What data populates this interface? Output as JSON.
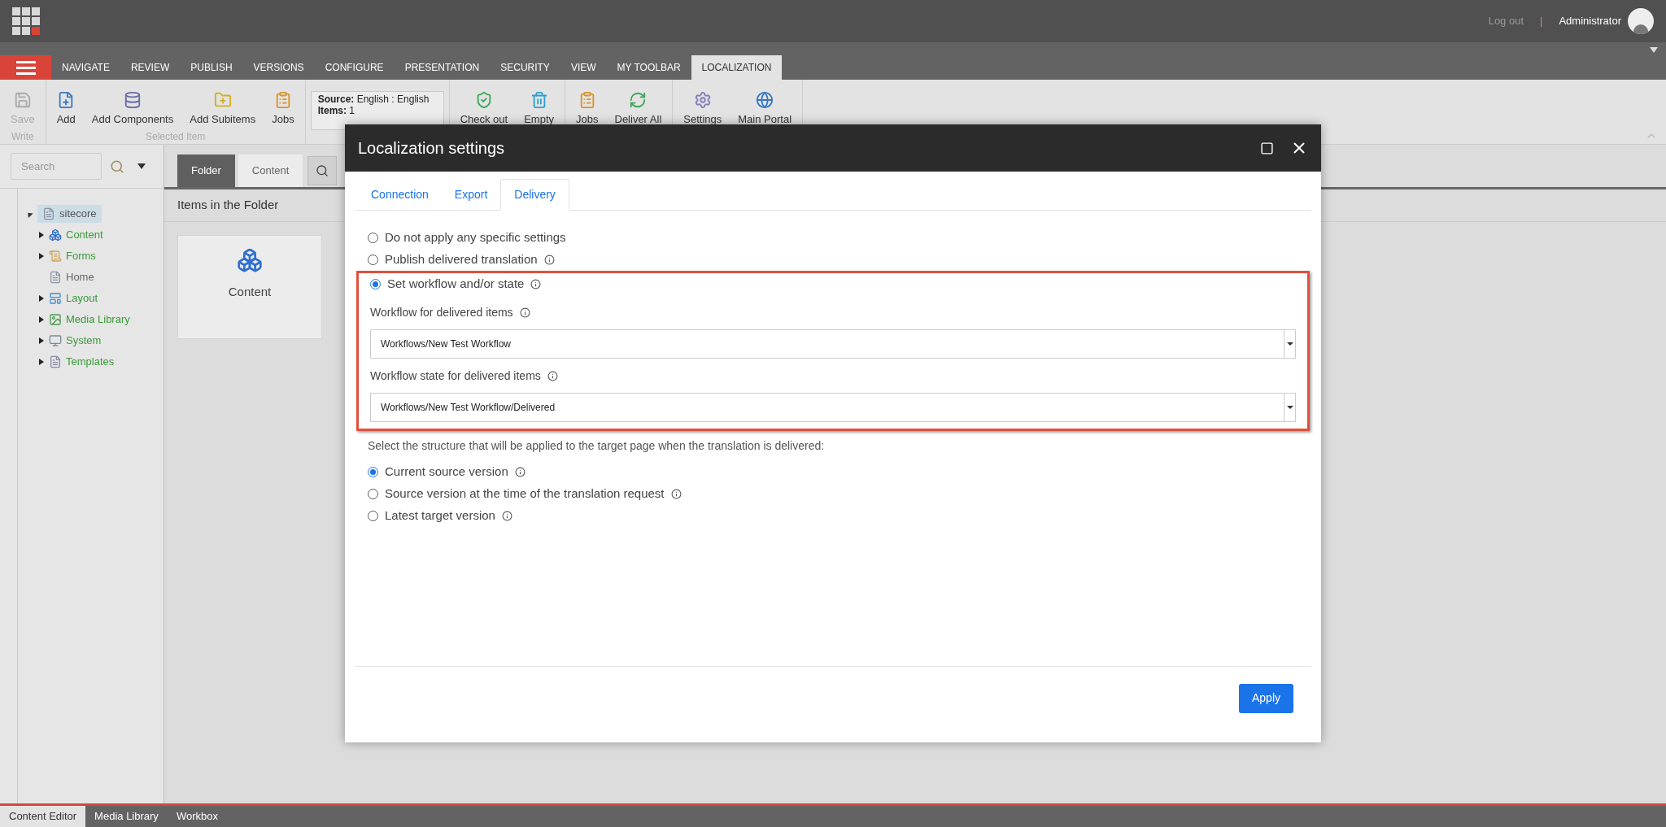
{
  "top_bar": {
    "logout": "Log out",
    "separator": "|",
    "user": "Administrator"
  },
  "ribbon_tabs": [
    {
      "label": "NAVIGATE",
      "selected": false
    },
    {
      "label": "REVIEW",
      "selected": false
    },
    {
      "label": "PUBLISH",
      "selected": false
    },
    {
      "label": "VERSIONS",
      "selected": false
    },
    {
      "label": "CONFIGURE",
      "selected": false
    },
    {
      "label": "PRESENTATION",
      "selected": false
    },
    {
      "label": "SECURITY",
      "selected": false
    },
    {
      "label": "VIEW",
      "selected": false
    },
    {
      "label": "MY TOOLBAR",
      "selected": false
    },
    {
      "label": "LOCALIZATION",
      "selected": true
    }
  ],
  "ribbon_groups": [
    {
      "label": "Write",
      "items": [
        {
          "label": "Save",
          "disabled": true
        }
      ]
    },
    {
      "label": "Selected Item",
      "items": [
        {
          "label": "Add",
          "disabled": false
        },
        {
          "label": "Add Components",
          "disabled": false
        },
        {
          "label": "Add Subitems",
          "disabled": false
        },
        {
          "label": "Jobs",
          "disabled": false
        }
      ]
    },
    {
      "info": {
        "source_label": "Source:",
        "source": "English : English",
        "items_label": "Items:",
        "items": "1"
      }
    },
    {
      "items": [
        {
          "label": "Check out",
          "disabled": false
        },
        {
          "label": "Empty",
          "disabled": false
        }
      ]
    },
    {
      "items": [
        {
          "label": "Jobs",
          "disabled": false
        },
        {
          "label": "Deliver All",
          "disabled": false
        }
      ]
    },
    {
      "items": [
        {
          "label": "Settings",
          "disabled": false
        },
        {
          "label": "Main Portal",
          "disabled": false
        }
      ]
    }
  ],
  "search": {
    "placeholder": "Search"
  },
  "tree": {
    "label": "sitecore",
    "selected": true,
    "expanded": true,
    "children": [
      {
        "label": "Content",
        "expandable": true
      },
      {
        "label": "Forms",
        "expandable": true
      },
      {
        "label": "Home",
        "expandable": false
      },
      {
        "label": "Layout",
        "expandable": true
      },
      {
        "label": "Media Library",
        "expandable": true
      },
      {
        "label": "System",
        "expandable": true
      },
      {
        "label": "Templates",
        "expandable": true
      }
    ]
  },
  "content_tabs": [
    {
      "label": "Folder",
      "selected": true
    },
    {
      "label": "Content",
      "selected": false
    }
  ],
  "folder": {
    "title": "Items in the Folder",
    "items": [
      {
        "label": "Content"
      }
    ]
  },
  "dialog": {
    "title": "Localization settings",
    "tabs": [
      {
        "label": "Connection",
        "selected": false
      },
      {
        "label": "Export",
        "selected": false
      },
      {
        "label": "Delivery",
        "selected": true
      }
    ],
    "delivery_options": [
      {
        "label": "Do not apply any specific settings",
        "selected": false,
        "info": false
      },
      {
        "label": "Publish delivered translation",
        "selected": false,
        "info": true
      },
      {
        "label": "Set workflow and/or state",
        "selected": true,
        "info": true
      }
    ],
    "fields": [
      {
        "label": "Workflow for delivered items",
        "value": "Workflows/New Test Workflow"
      },
      {
        "label": "Workflow state for delivered items",
        "value": "Workflows/New Test Workflow/Delivered"
      }
    ],
    "structure_prompt": "Select the structure that will be applied to the target page when the translation is delivered:",
    "structure_options": [
      {
        "label": "Current source version",
        "selected": true,
        "info": true
      },
      {
        "label": "Source version at the time of the translation request",
        "selected": false,
        "info": true
      },
      {
        "label": "Latest target version",
        "selected": false,
        "info": true
      }
    ],
    "apply": "Apply"
  },
  "app_tabs": [
    {
      "label": "Content Editor",
      "selected": true
    },
    {
      "label": "Media Library",
      "selected": false
    },
    {
      "label": "Workbox",
      "selected": false
    }
  ]
}
